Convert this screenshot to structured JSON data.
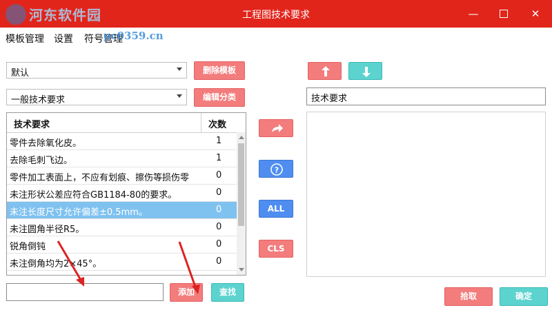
{
  "window": {
    "title": "工程图技术要求",
    "watermark": "河东软件园",
    "watermark_url": "pc0359.cn"
  },
  "menu": [
    "模板管理",
    "设置",
    "符号管理"
  ],
  "template_select": {
    "value": "默认"
  },
  "category_select": {
    "value": "一般技术要求"
  },
  "buttons": {
    "delete_template": "删除模板",
    "edit_category": "编辑分类",
    "add": "添加",
    "search": "查找",
    "all": "ALL",
    "cls": "CLS",
    "pick": "拾取",
    "ok": "确定"
  },
  "table": {
    "headers": [
      "技术要求",
      "次数"
    ],
    "rows": [
      {
        "text": "零件去除氧化皮。",
        "count": "1"
      },
      {
        "text": "去除毛刺飞边。",
        "count": "1"
      },
      {
        "text": "零件加工表面上，不应有划痕、擦伤等损伤零",
        "count": "0"
      },
      {
        "text": "未注形状公差应符合GB1184-80的要求。",
        "count": "0"
      },
      {
        "text": "未注长度尺寸允许偏差±0.5mm。",
        "count": "0"
      },
      {
        "text": "未注圆角半径R5。",
        "count": "0"
      },
      {
        "text": "锐角倒钝",
        "count": "0"
      },
      {
        "text": "未注倒角均为2×45°。",
        "count": "0"
      }
    ],
    "selected_index": 4
  },
  "right_title_field": {
    "value": "技术要求"
  },
  "colors": {
    "titlebar": "#e1251b",
    "selection": "#7fc2f0",
    "red_button": "#f37c7c",
    "teal_button": "#5cd3cf",
    "blue_button": "#4f8ef0"
  }
}
